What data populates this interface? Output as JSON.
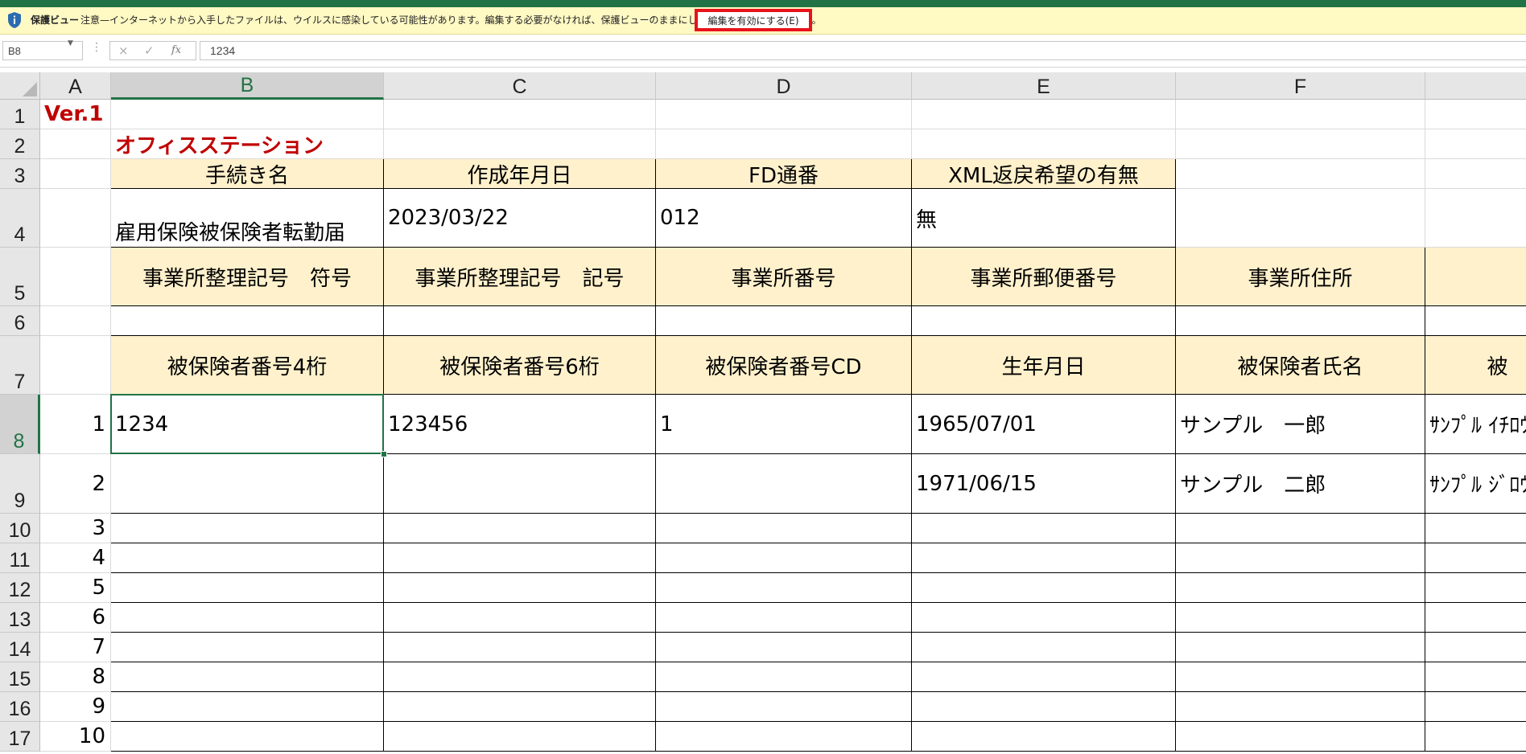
{
  "message_bar": {
    "title": "保護ビュー",
    "text": "注意—インターネットから入手したファイルは、ウイルスに感染している可能性があります。編集する必要がなければ、保護ビューのままにしておくことをお勧めします。",
    "enable_button": "編集を有効にする(E)",
    "icon": "shield-info-icon"
  },
  "formula_bar": {
    "name_box": "B8",
    "cancel_icon": "×",
    "enter_icon": "✓",
    "fx_icon": "fx",
    "formula": "1234"
  },
  "columns": [
    "A",
    "B",
    "C",
    "D",
    "E",
    "F"
  ],
  "rows": [
    "1",
    "2",
    "3",
    "4",
    "5",
    "6",
    "7",
    "8",
    "9",
    "10",
    "11",
    "12",
    "13",
    "14",
    "15",
    "16",
    "17"
  ],
  "cells": {
    "A1": "Ver.1",
    "B2": "オフィスステーション",
    "B3": "手続き名",
    "C3": "作成年月日",
    "D3": "FD通番",
    "E3": "XML返戻希望の有無",
    "B4": "雇用保険被保険者転勤届",
    "C4": "2023/03/22",
    "D4": "012",
    "E4": "無",
    "B5": "事業所整理記号　符号",
    "C5": "事業所整理記号　記号",
    "D5": "事業所番号",
    "E5": "事業所郵便番号",
    "F5": "事業所住所",
    "B7": "被保険者番号4桁",
    "C7": "被保険者番号6桁",
    "D7": "被保険者番号CD",
    "E7": "生年月日",
    "F7": "被保険者氏名",
    "G7": "被",
    "A8": "1",
    "B8": "1234",
    "C8": "123456",
    "D8": "1",
    "E8": "1965/07/01",
    "F8": "サンプル　一郎",
    "G8": "ｻﾝﾌﾟﾙ ｲﾁﾛｳ",
    "A9": "2",
    "E9": "1971/06/15",
    "F9": "サンプル　二郎",
    "G9": "ｻﾝﾌﾟﾙ ｼﾞﾛｳ",
    "A10": "3",
    "A11": "4",
    "A12": "5",
    "A13": "6",
    "A14": "7",
    "A15": "8",
    "A16": "9",
    "A17": "10"
  },
  "selected_cell": "B8",
  "colors": {
    "accent": "#217346",
    "header_fill": "#fff1cc",
    "title_red": "#c00000",
    "message_bar": "#fff9c4",
    "highlight_red": "#e8121a"
  }
}
